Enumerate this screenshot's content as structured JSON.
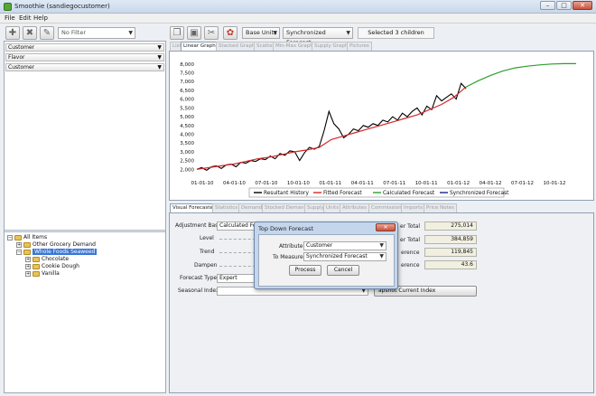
{
  "window": {
    "title": "Smoothie (sandiegocustomer)"
  },
  "menu": [
    "File",
    "Edit",
    "Help"
  ],
  "left_toolbar": {
    "filter": "No Filter"
  },
  "dimensions": [
    "Customer",
    "Flavor",
    "Customer"
  ],
  "tree": {
    "root": "All Items",
    "items": [
      {
        "label": "Other Grocery Demand",
        "level": 1
      },
      {
        "label": "Whole Foods Seaweed",
        "level": 1,
        "selected": true
      },
      {
        "label": "Chocolate",
        "level": 2
      },
      {
        "label": "Cookie Dough",
        "level": 2
      },
      {
        "label": "Vanilla",
        "level": 2
      }
    ]
  },
  "right_toolbar": {
    "units": "Base Units",
    "measure": "Synchronized Forecast",
    "selection": "Selected 3 children"
  },
  "graph_tabs": [
    "List",
    "Linear Graph",
    "Stacked Graph",
    "Scatter",
    "Min-Max Graph",
    "Supply Graph",
    "Pictures"
  ],
  "graph_active_tab": 1,
  "chart_data": {
    "type": "line",
    "ylim": [
      1500,
      8300
    ],
    "yticks": [
      "2,000",
      "2,500",
      "3,000",
      "3,500",
      "4,000",
      "4,500",
      "5,000",
      "5,500",
      "6,000",
      "6,500",
      "7,000",
      "7,500",
      "8,000"
    ],
    "xticks": [
      "01-01-10",
      "04-01-10",
      "07-01-10",
      "10-01-10",
      "01-01-11",
      "04-01-11",
      "07-01-11",
      "10-01-11",
      "01-01-12",
      "04-01-12",
      "07-01-12",
      "10-01-12"
    ],
    "x_index_range": [
      0,
      155
    ],
    "series": [
      {
        "name": "Resultant History",
        "color": "#000000",
        "x": [
          0,
          2,
          4,
          6,
          8,
          10,
          12,
          14,
          16,
          18,
          20,
          22,
          24,
          26,
          28,
          30,
          32,
          34,
          36,
          38,
          40,
          42,
          44,
          46,
          48,
          50,
          52,
          54,
          56,
          58,
          60,
          62,
          64,
          66,
          68,
          70,
          72,
          74,
          76,
          78,
          80,
          82,
          84,
          86,
          88,
          90,
          92,
          94,
          96,
          98,
          100,
          102,
          104,
          106,
          108,
          110
        ],
        "y": [
          2000,
          2100,
          1950,
          2150,
          2200,
          2050,
          2250,
          2300,
          2150,
          2400,
          2350,
          2500,
          2450,
          2600,
          2550,
          2750,
          2600,
          2900,
          2800,
          3050,
          3000,
          2500,
          2950,
          3250,
          3150,
          3300,
          4200,
          5300,
          4600,
          4300,
          3800,
          4000,
          4300,
          4200,
          4500,
          4400,
          4600,
          4500,
          4800,
          4700,
          5000,
          4800,
          5200,
          5000,
          5300,
          5500,
          5100,
          5600,
          5400,
          6200,
          5900,
          6100,
          6300,
          6000,
          6900,
          6600
        ]
      },
      {
        "name": "Fitted Forecast",
        "color": "#d62728",
        "x": [
          0,
          5,
          10,
          15,
          20,
          25,
          30,
          35,
          40,
          45,
          50,
          55,
          60,
          65,
          70,
          75,
          80,
          85,
          90,
          95,
          100,
          105,
          110
        ],
        "y": [
          2000,
          2100,
          2200,
          2300,
          2450,
          2600,
          2700,
          2850,
          3000,
          3100,
          3250,
          3700,
          3900,
          4100,
          4300,
          4500,
          4700,
          4900,
          5100,
          5400,
          5700,
          6100,
          6700
        ]
      },
      {
        "name": "Calculated Forecast",
        "color": "#2ca02c",
        "x": [
          110,
          115,
          120,
          125,
          130,
          135,
          140,
          145,
          150,
          155
        ],
        "y": [
          6700,
          7050,
          7350,
          7600,
          7780,
          7880,
          7950,
          8000,
          8020,
          8020
        ]
      },
      {
        "name": "Synchronized Forecast",
        "color": "#1f1f8f",
        "x": [],
        "y": []
      }
    ]
  },
  "fc_tabs": [
    "Visual Forecaster",
    "Statistics",
    "Demand",
    "Stocked Demand",
    "Supply",
    "Units",
    "Attributes",
    "Commission",
    "Imports",
    "Price Notes"
  ],
  "forecaster": {
    "adjustment_basis_label": "Adjustment Basis",
    "adjustment_basis_value": "Calculated Forec",
    "level_label": "Level",
    "trend_label": "Trend",
    "dampen_label": "Dampen",
    "forecast_type_label": "Forecast Type",
    "forecast_type_value": "Expert",
    "seasonal_index_label": "Seasonal Index",
    "totals": [
      {
        "label": "er Total",
        "value": "275,014"
      },
      {
        "label": "er Total",
        "value": "384,859"
      },
      {
        "label": "erence",
        "value": "119,845"
      },
      {
        "label": "erence",
        "value": "43.6"
      }
    ],
    "snapshot_button": "apshot Current Index"
  },
  "dialog": {
    "title": "Top Down Forecast",
    "attribute_label": "Attribute",
    "attribute_value": "Customer",
    "measure_label": "To Measure",
    "measure_value": "Synchronized Forecast",
    "process_button": "Process",
    "cancel_button": "Cancel"
  }
}
